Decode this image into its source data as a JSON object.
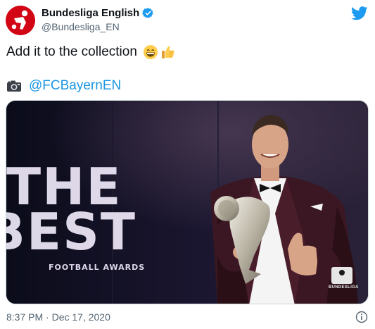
{
  "author": {
    "display_name": "Bundesliga English",
    "handle": "@Bundesliga_EN",
    "verified": true,
    "avatar_icon": "bundesliga-logo-icon",
    "avatar_color": "#d20515"
  },
  "tweet": {
    "text": "Add it to the collection",
    "emojis": [
      "grinning-face-icon",
      "thumbs-up-icon"
    ],
    "credit_icon": "camera-icon",
    "credit_mention": "@FCBayernEN"
  },
  "media": {
    "backdrop_text_line1": "THE",
    "backdrop_text_line2": "BEST",
    "backdrop_subtitle": "FOOTBALL AWARDS",
    "watermark_label": "BUNDESLIGA"
  },
  "footer": {
    "timestamp": "8:37 PM · Dec 17, 2020",
    "info_icon": "info-icon"
  },
  "colors": {
    "link": "#1b95e0",
    "twitter_blue": "#1d9bf0",
    "text_secondary": "#536471"
  }
}
